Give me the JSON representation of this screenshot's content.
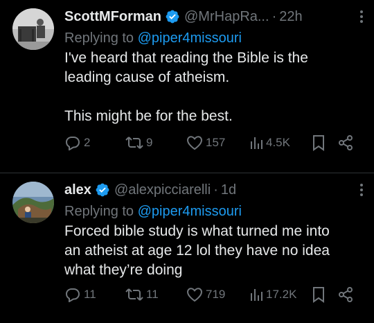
{
  "tweets": [
    {
      "name": "ScottMForman",
      "handle": "@MrHapRa...",
      "time": "22h",
      "reply_prefix": "Replying to",
      "reply_to": "@piper4missouri",
      "text": "I've heard that reading the Bible is the\nleading cause of atheism.\n\nThis might be for the best.",
      "replies": "2",
      "retweets": "9",
      "likes": "157",
      "views": "4.5K"
    },
    {
      "name": "alex",
      "handle": "@alexpicciarelli",
      "time": "1d",
      "reply_prefix": "Replying to",
      "reply_to": "@piper4missouri",
      "text": "Forced bible study is what turned me into\nan atheist at age 12 lol they have no idea\nwhat they’re doing",
      "replies": "11",
      "retweets": "11",
      "likes": "719",
      "views": "17.2K"
    }
  ],
  "separator": "·",
  "colors": {
    "background": "#000000",
    "text": "#e7e9ea",
    "muted": "#71767b",
    "link": "#1d9bf0",
    "verified": "#1d9bf0"
  }
}
